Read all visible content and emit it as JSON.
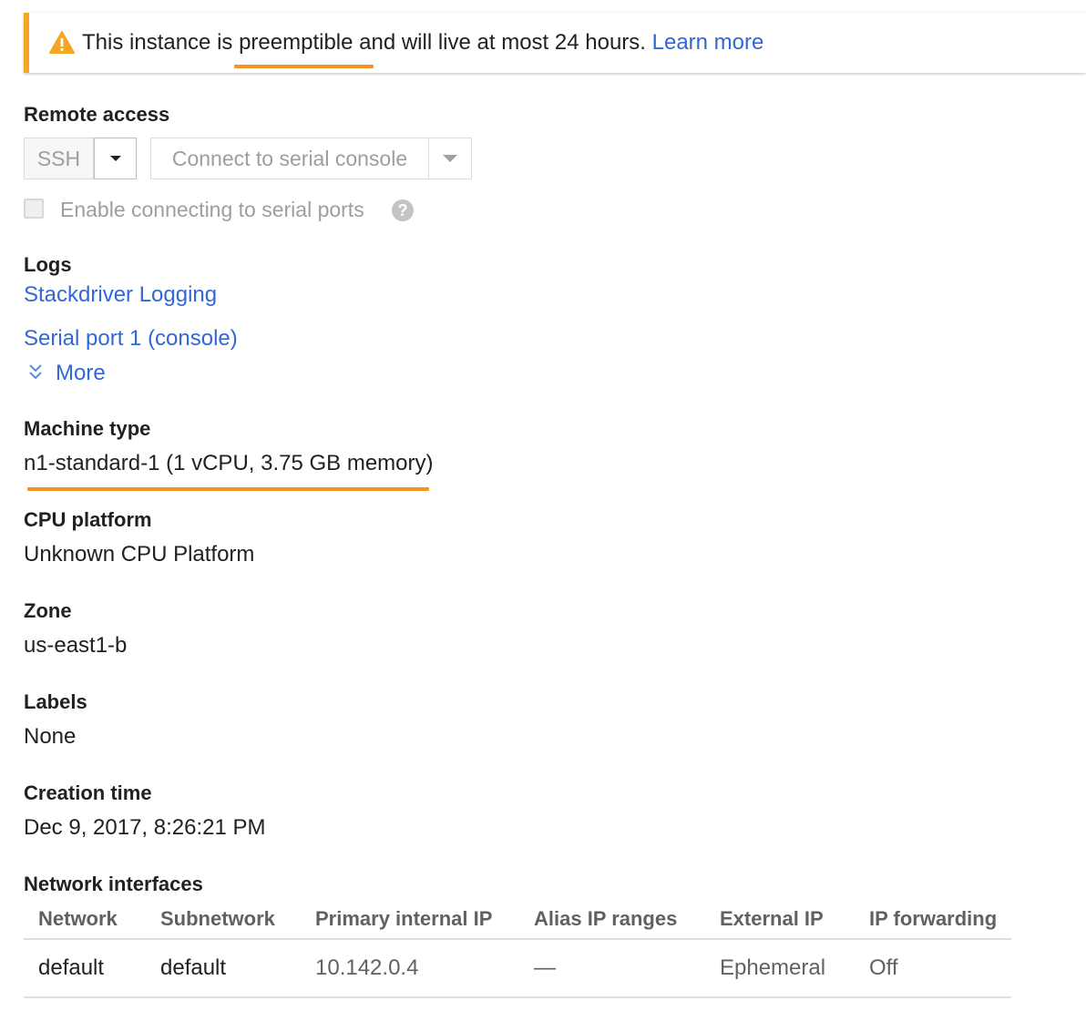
{
  "banner": {
    "message": "This instance is preemptible and will live at most 24 hours.",
    "link": "Learn more"
  },
  "remote_access": {
    "label": "Remote access",
    "ssh_button": "SSH",
    "serial_console_button": "Connect to serial console",
    "serial_ports_checkbox": {
      "label": "Enable connecting to serial ports",
      "checked": false
    }
  },
  "logs": {
    "label": "Logs",
    "stackdriver_link": "Stackdriver Logging",
    "serial_port_link": "Serial port 1 (console)",
    "more_link": "More"
  },
  "machine_type": {
    "label": "Machine type",
    "value": "n1-standard-1 (1 vCPU, 3.75 GB memory)"
  },
  "cpu_platform": {
    "label": "CPU platform",
    "value": "Unknown CPU Platform"
  },
  "zone": {
    "label": "Zone",
    "value": "us-east1-b"
  },
  "labels": {
    "label": "Labels",
    "value": "None"
  },
  "creation_time": {
    "label": "Creation time",
    "value": "Dec 9, 2017, 8:26:21 PM"
  },
  "network_interfaces": {
    "label": "Network interfaces",
    "columns": [
      "Network",
      "Subnetwork",
      "Primary internal IP",
      "Alias IP ranges",
      "External IP",
      "IP forwarding"
    ],
    "rows": [
      [
        "default",
        "default",
        "10.142.0.4",
        "—",
        "Ephemeral",
        "Off"
      ]
    ]
  },
  "colors": {
    "link": "#3367d6",
    "warning": "#f5a623",
    "highlight": "#f5931f"
  }
}
